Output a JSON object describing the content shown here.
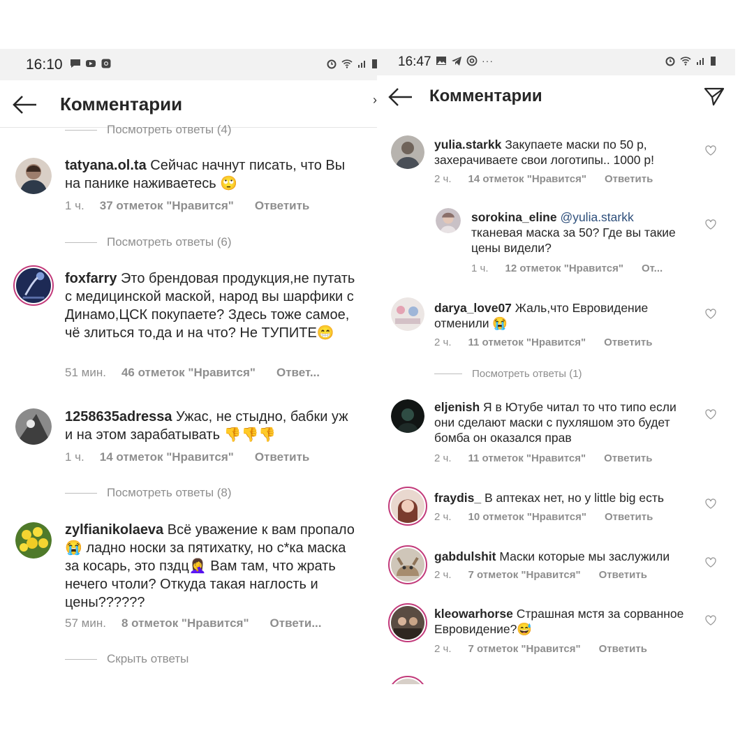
{
  "left": {
    "status_time": "16:10",
    "title": "Комментарии",
    "top_replies_cut": "Посмотреть ответы (4)",
    "comments": [
      {
        "user": "tatyana.ol.ta",
        "text": "Сейчас начнут писать, что Вы на панике наживаетесь 🙄",
        "time": "1 ч.",
        "likes": "37 отметок \"Нравится\"",
        "reply": "Ответить",
        "replies": "Посмотреть ответы (6)"
      },
      {
        "user": "foxfarry",
        "text": "Это брендовая продукция,не путать с медицинской маской, народ вы шарфики с Динамо,ЦСК покупаете? Здесь тоже самое, чё злиться то,да и на что? Не ТУПИТЕ😁",
        "time": "51 мин.",
        "likes": "46 отметок \"Нравится\"",
        "reply": "Ответ..."
      },
      {
        "user": "1258635adressa",
        "text": "Ужас,  не стыдно,  бабки уж и на этом зарабатывать 👎👎👎",
        "time": "1 ч.",
        "likes": "14 отметок \"Нравится\"",
        "reply": "Ответить",
        "replies": "Посмотреть ответы (8)"
      },
      {
        "user": "zylfianikolaeva",
        "text": "Всё уважение к вам пропало😭 ладно носки за пятихатку, но с*ка маска за косарь, это пздц🤦‍♀️ Вам там, что жрать нечего чтоли? Откуда такая наглость и цены??????",
        "time": "57 мин.",
        "likes": "8 отметок \"Нравится\"",
        "reply": "Ответи...",
        "replies": "Скрыть ответы"
      }
    ]
  },
  "right": {
    "status_time": "16:47",
    "status_more": "···",
    "title": "Комментарии",
    "comments": [
      {
        "user": "yulia.starkk",
        "text": "Закупаете маски по 50 р, захерачиваете свои логотипы.. 1000 р!",
        "time": "2 ч.",
        "likes": "14 отметок \"Нравится\"",
        "reply": "Ответить"
      },
      {
        "user": "sorokina_eline",
        "mention": "@yulia.starkk",
        "text": "тканевая маска за 50? Где вы такие цены видели?",
        "time": "1 ч.",
        "likes": "12 отметок \"Нравится\"",
        "reply": "От..."
      },
      {
        "user": "darya_love07",
        "text": "Жаль,что Евровидение отменили 😭",
        "time": "2 ч.",
        "likes": "11 отметок \"Нравится\"",
        "reply": "Ответить",
        "replies": "Посмотреть ответы (1)"
      },
      {
        "user": "eljenish",
        "text": "Я в Ютубе читал то что типо если они сделают маски с пухляшом это будет бомба он оказался прав",
        "time": "2 ч.",
        "likes": "11 отметок \"Нравится\"",
        "reply": "Ответить"
      },
      {
        "user": "fraydis_",
        "text": "В аптеках нет, но у little big есть",
        "time": "2 ч.",
        "likes": "10 отметок \"Нравится\"",
        "reply": "Ответить"
      },
      {
        "user": "gabdulshit",
        "text": "Маски которые мы заслужили",
        "time": "2 ч.",
        "likes": "7 отметок \"Нравится\"",
        "reply": "Ответить"
      },
      {
        "user": "kleowarhorse",
        "text": "Страшная мстя за сорванное Евровидение?😅",
        "time": "2 ч.",
        "likes": "7 отметок \"Нравится\"",
        "reply": "Ответить"
      }
    ]
  },
  "icons": {
    "back": "arrow-left-icon",
    "send": "paper-plane-icon",
    "heart": "heart-outline-icon"
  },
  "colors": {
    "statusbar_bg": "#f2f2f2",
    "meta_gray": "#8e8e8e",
    "story_ring": "#c23a7a",
    "mention_blue": "#2d4e7a"
  }
}
